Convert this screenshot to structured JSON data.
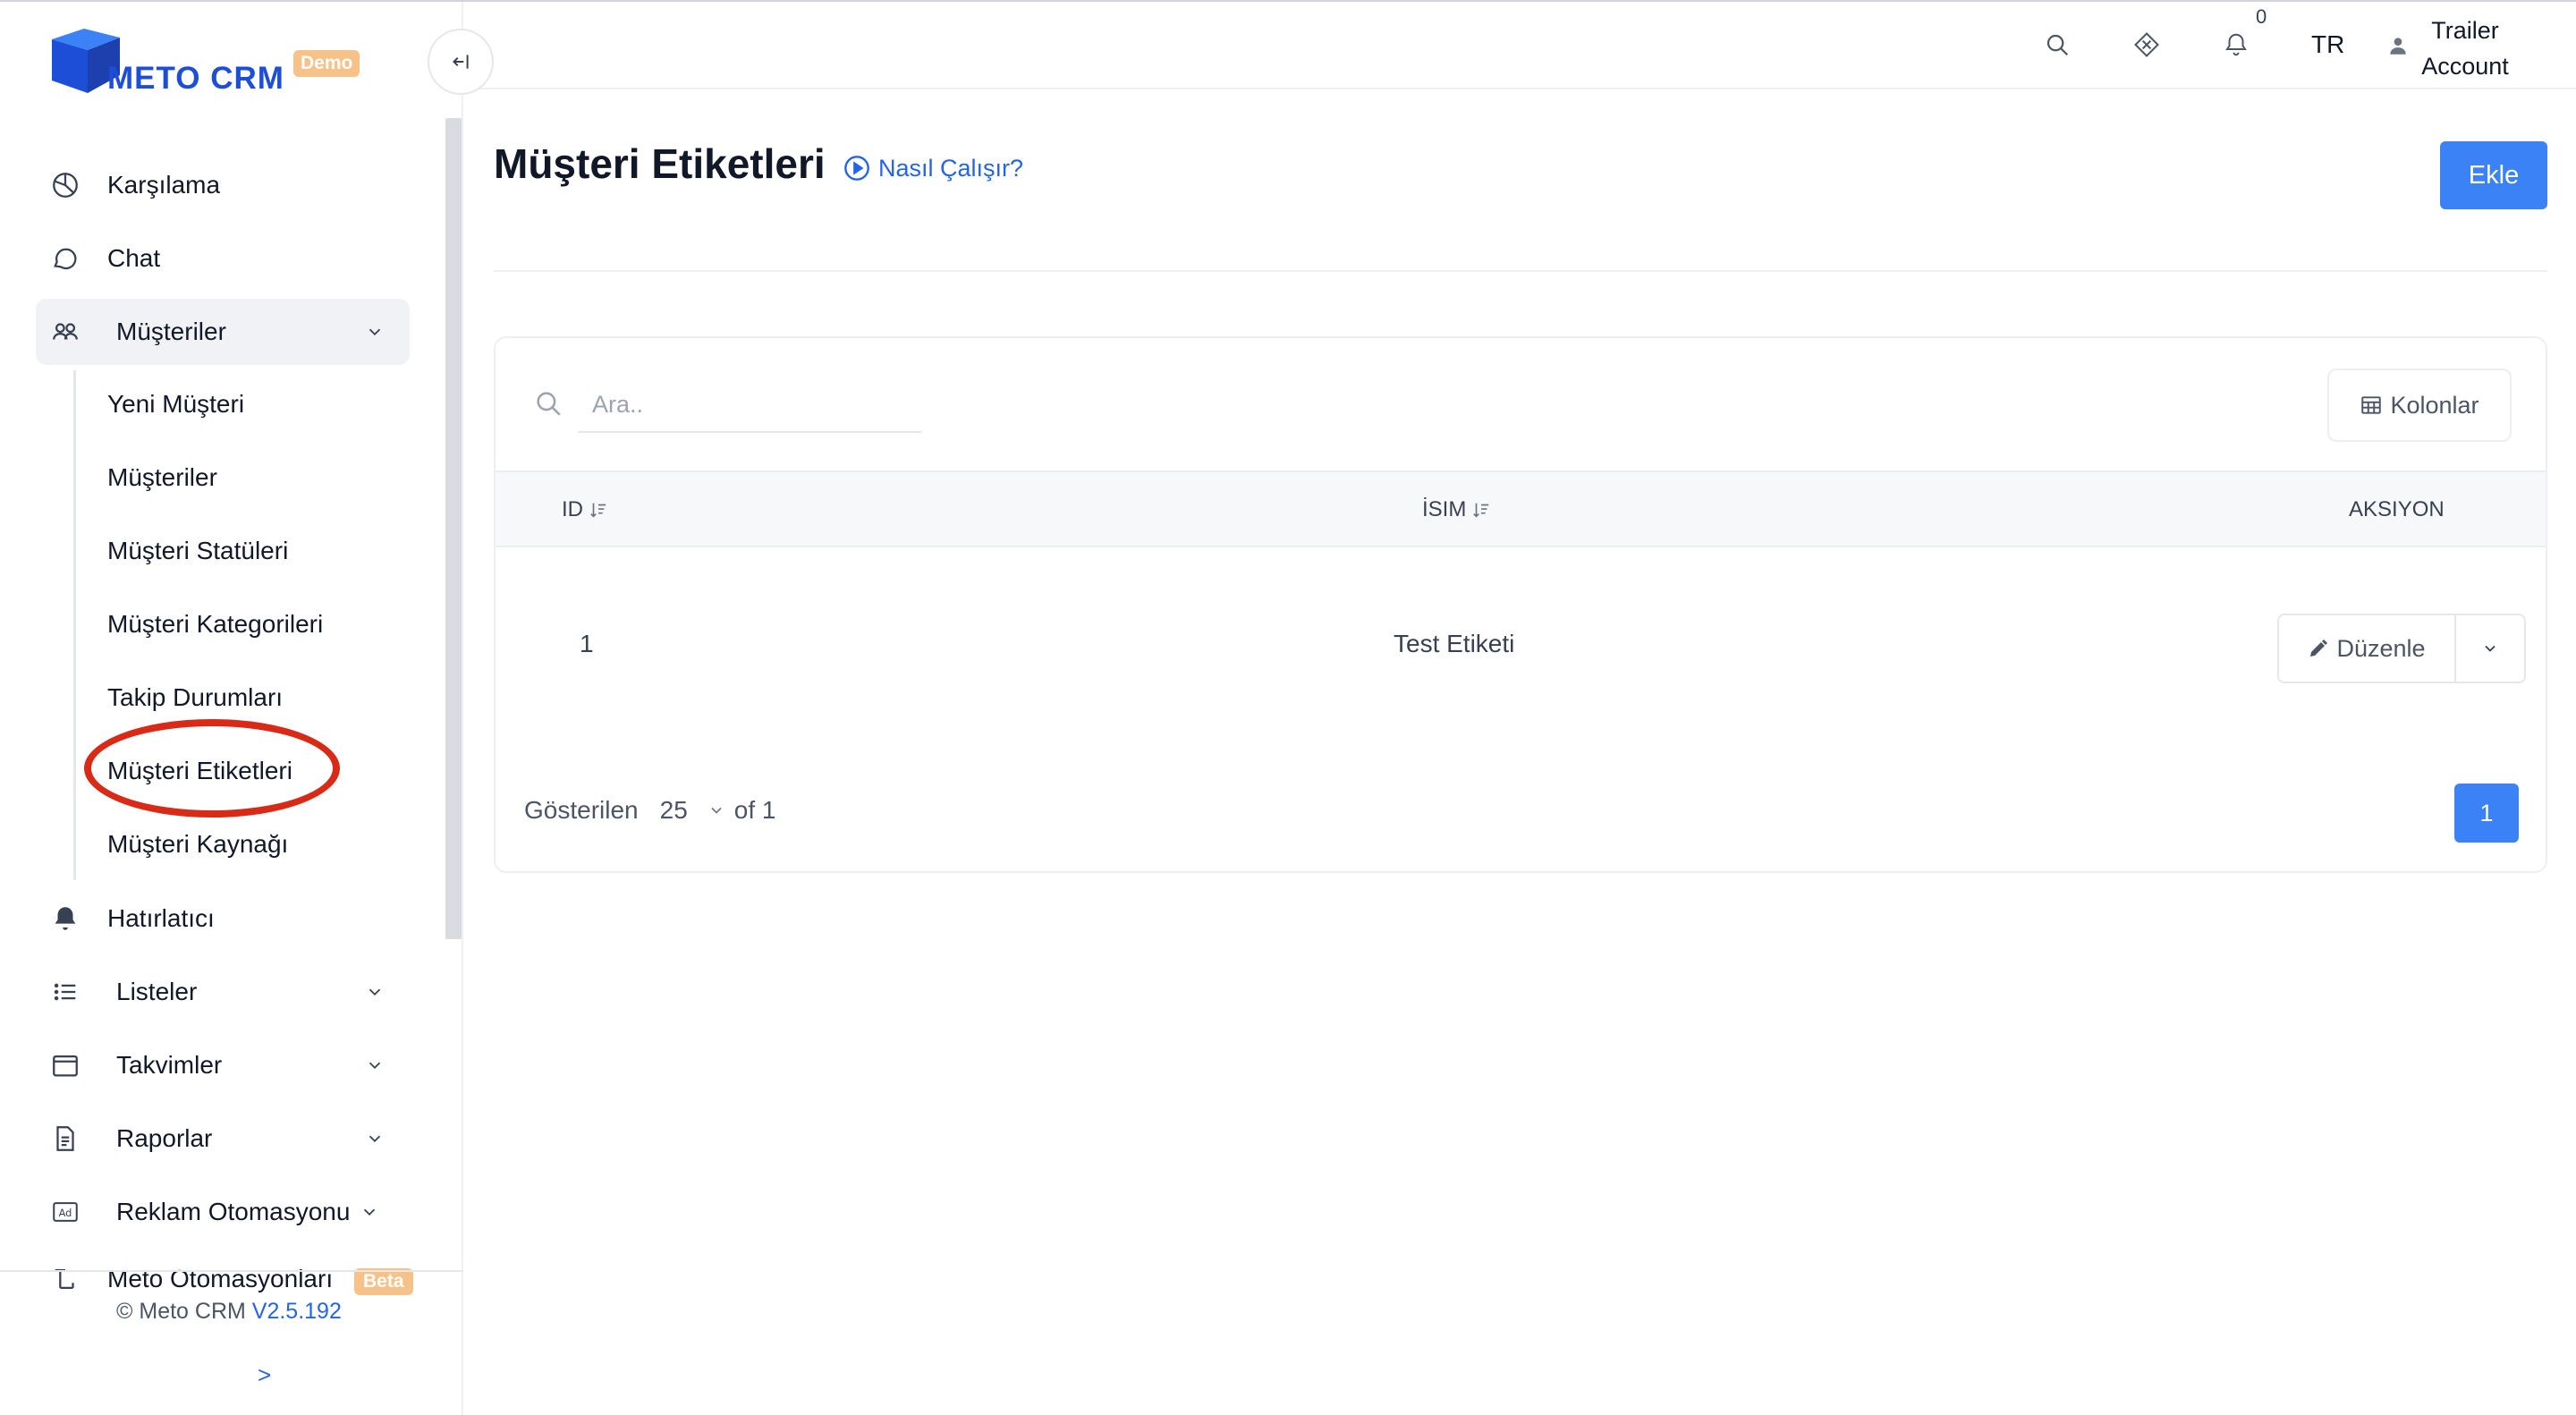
{
  "brand": {
    "name": "METO CRM",
    "badge": "Demo",
    "accent": "#1d4ed8"
  },
  "sidebar": {
    "items": [
      {
        "label": "Karşılama",
        "icon": "dashboard-pie-icon"
      },
      {
        "label": "Chat",
        "icon": "chat-bubble-icon"
      },
      {
        "label": "Müşteriler",
        "icon": "users-icon",
        "expanded": true,
        "children": [
          "Yeni Müşteri",
          "Müşteriler",
          "Müşteri Statüleri",
          "Müşteri Kategorileri",
          "Takip Durumları",
          "Müşteri Etiketleri",
          "Müşteri Kaynağı"
        ]
      },
      {
        "label": "Hatırlatıcı",
        "icon": "bell-filled-icon"
      },
      {
        "label": "Listeler",
        "icon": "list-icon"
      },
      {
        "label": "Takvimler",
        "icon": "calendar-icon"
      },
      {
        "label": "Raporlar",
        "icon": "report-file-icon"
      },
      {
        "label": "Reklam Otomasyonu",
        "icon": "ad-icon"
      },
      {
        "label": "Meto Otomasyonları",
        "icon": "automation-icon",
        "badge": "Beta"
      }
    ],
    "highlighted_item": "Müşteri Etiketleri",
    "footer": {
      "copyright": "© Meto CRM",
      "version": "V2.5.192",
      "expand": ">"
    }
  },
  "header": {
    "notification_count": "0",
    "language": "TR",
    "user": "Trailer Account"
  },
  "main": {
    "title": "Müşteri Etiketleri",
    "how_link": "Nasıl Çalışır?",
    "add_button": "Ekle",
    "search": {
      "placeholder": "Ara..",
      "value": ""
    },
    "columns_button": "Kolonlar",
    "table": {
      "headers": [
        "ID",
        "İSIM",
        "AKSIYON"
      ],
      "rows": [
        {
          "id": "1",
          "name": "Test Etiketi",
          "action": "Düzenle"
        }
      ]
    },
    "pagination": {
      "showing_label": "Gösterilen",
      "page_size": "25",
      "of_label": "of 1",
      "current_page": "1"
    }
  },
  "colors": {
    "primary": "#3b82f6",
    "highlight_ring": "#d92a17",
    "badge": "#f7c28a"
  }
}
